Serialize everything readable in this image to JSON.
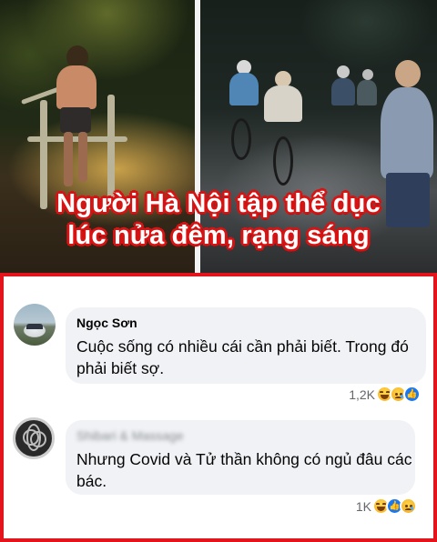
{
  "banner": {
    "headline_line1": "Người Hà Nội tập thể dục",
    "headline_line2": "lúc nửa đêm, rạng sáng"
  },
  "comments": [
    {
      "author": "Ngọc Sơn",
      "text": "Cuộc sống có nhiều cái cần phải biết. Trong đó phải biết sợ.",
      "reaction_count": "1,2K",
      "reactions": [
        "haha-icon",
        "sad-icon",
        "like-icon"
      ]
    },
    {
      "author": "Shibari & Massage",
      "text": "Nhưng Covid và Tử thần không có ngủ đâu các bác.",
      "reaction_count": "1K",
      "reactions": [
        "haha-icon",
        "like-icon",
        "sad-icon"
      ]
    }
  ],
  "colors": {
    "frame_red": "#e3141b",
    "headline_outline": "#d61414",
    "bubble_bg": "#f0f2f5",
    "muted_text": "#65676b",
    "like_blue": "#1877f2"
  }
}
